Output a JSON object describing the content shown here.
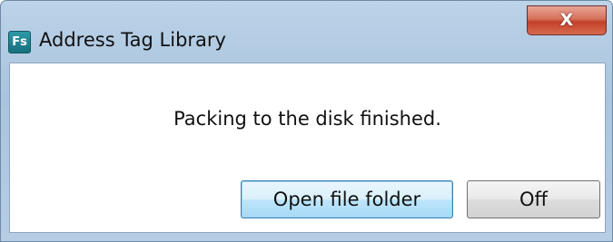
{
  "window": {
    "title": "Address Tag Library",
    "app_icon_label": "Fs",
    "close_glyph": "X",
    "icon_name": "app-icon"
  },
  "dialog": {
    "message": "Packing to the disk finished.",
    "buttons": {
      "open_folder_label": "Open file folder",
      "off_label": "Off"
    }
  },
  "colors": {
    "titlebar": "#a9c4de",
    "close_button": "#c2412a",
    "primary_button": "#bee6fd",
    "content_background": "#ffffff"
  }
}
